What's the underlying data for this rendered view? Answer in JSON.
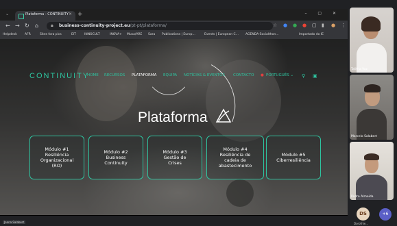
{
  "browser": {
    "tab_title": "Plataforma - CONTINUITY",
    "tab_close": "×",
    "new_tab": "+",
    "window_controls": "– ▢ ✕",
    "url_host": "business-continuity-project.eu",
    "url_path": "/pt-pt/plataforma/",
    "bookmarks": [
      "Helpdesk",
      "AFR",
      "Sites fora pics",
      "EIT",
      "INNOCULT",
      "INOVA+",
      "Musa/ARE",
      "Sara",
      "Publications | Europ...",
      "Events | European C...",
      "AGENDA-Socialthon...",
      "Importado do IE"
    ]
  },
  "site": {
    "logo": "CONTINUITY",
    "menu": [
      "HOME",
      "RECURSOS",
      "PLATAFORMA",
      "EQUIPA",
      "NOTÍCIAS & EVENTOS",
      "CONTACTO",
      "PORTUGUÊS ⌄"
    ],
    "active_menu_index": 2,
    "hero_title": "Plataforma",
    "modules": [
      {
        "label": "Módulo #1\nResiliência\nOrganizacional\n(RO)"
      },
      {
        "label": "Módulo #2\nBusiness\nContinuity"
      },
      {
        "label": "Módulo #3\nGestão de\nCrises"
      },
      {
        "label": "Módulo #4\nResiliência de\ncadeia de\nabastecimento"
      },
      {
        "label": "Módulo #5\nCiberresiliência"
      }
    ],
    "accent_color": "#2ec4a0"
  },
  "meeting": {
    "participants": [
      {
        "name": "Talitha Vaz"
      },
      {
        "name": "Marcelo Salabert"
      },
      {
        "name": "Pedro Almeida"
      }
    ],
    "avatar_initials": "DS",
    "avatar_label": "Dorothie...",
    "more_count": "+6",
    "presenter_label": "Joana Salabert"
  }
}
